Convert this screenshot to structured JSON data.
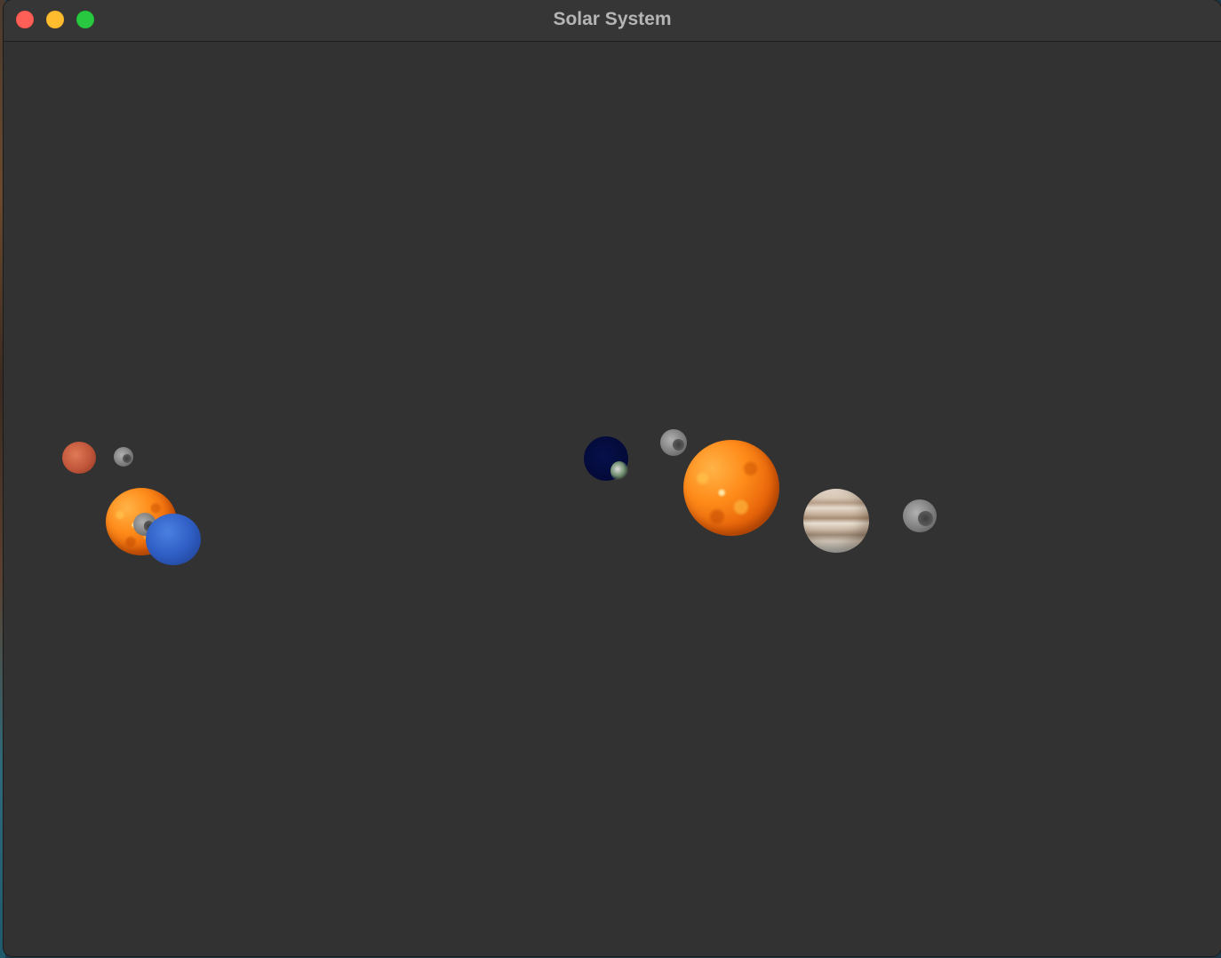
{
  "window": {
    "title": "Solar System"
  },
  "bodies": [
    {
      "name": "mars",
      "color": "#c0553a"
    },
    {
      "name": "moon",
      "color": "#888888"
    },
    {
      "name": "sun",
      "color": "#ff8c1a"
    },
    {
      "name": "neptune",
      "color": "#2f5ec4"
    },
    {
      "name": "earth",
      "color": "#040a38"
    },
    {
      "name": "jupiter",
      "color": "#d8c8b6"
    }
  ]
}
